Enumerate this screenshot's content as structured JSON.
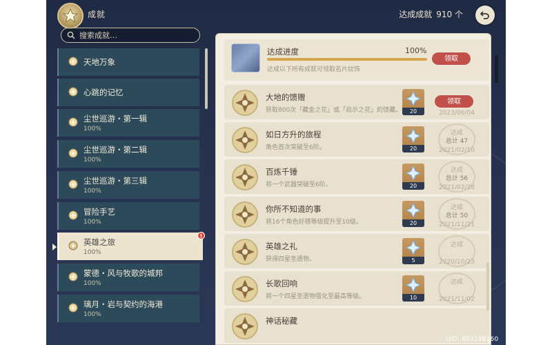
{
  "header": {
    "title": "成就",
    "total_label": "达成成就",
    "total_count": "910",
    "count_suffix": "个"
  },
  "search": {
    "placeholder": "搜索成就…"
  },
  "categories": [
    {
      "name": "天地万象",
      "percent": ""
    },
    {
      "name": "心跳的记忆",
      "percent": ""
    },
    {
      "name": "尘世巡游・第一辑",
      "percent": "100%"
    },
    {
      "name": "尘世巡游・第二辑",
      "percent": "100%"
    },
    {
      "name": "尘世巡游・第三辑",
      "percent": "100%"
    },
    {
      "name": "冒险手艺",
      "percent": "100%"
    },
    {
      "name": "英雄之旅",
      "percent": "100%"
    },
    {
      "name": "蒙德・风与牧歌的城邦",
      "percent": "100%"
    },
    {
      "name": "璃月・岩与契约的海港",
      "percent": "100%"
    }
  ],
  "selected_category_badge": "!",
  "progress": {
    "label": "达成进度",
    "percent": "100%",
    "fraction": 1.0,
    "description": "达成以下所有成就可领取名片纹饰",
    "claim_label": "领取"
  },
  "achievements": [
    {
      "name": "大地的馈赠",
      "description": "获取800次「藏金之花」或「启示之花」的馈藏。",
      "reward": "20",
      "status": "",
      "total": "",
      "date": "2023/06/04",
      "claim_label": "领取"
    },
    {
      "name": "如日方升的旅程",
      "description": "角色首次突破至6阶。",
      "reward": "20",
      "status": "达成",
      "total": "总计 47",
      "date": "2021/02/10"
    },
    {
      "name": "百炼千锤",
      "description": "将一个武器突破至6阶。",
      "reward": "20",
      "status": "达成",
      "total": "总计 56",
      "date": "2021/02/28"
    },
    {
      "name": "你所不知道的事",
      "description": "将16个角色好感等级提升至10级。",
      "reward": "20",
      "status": "达成",
      "total": "总计 50",
      "date": "2021/11/21"
    },
    {
      "name": "英雄之礼",
      "description": "获得四星圣遗物。",
      "reward": "5",
      "status": "达成",
      "total": "",
      "date": "2020/10/23"
    },
    {
      "name": "长歌回响",
      "description": "将一个四星圣遗物强化至最高等级。",
      "reward": "10",
      "status": "达成",
      "total": "",
      "date": "2021/11/02"
    },
    {
      "name": "神话秘藏",
      "description": "",
      "reward": "",
      "status": "",
      "total": "",
      "date": ""
    }
  ],
  "uid": "UID: 803198160",
  "colors": {
    "claim_button": "#c2504a",
    "progress_fill": "#d7a54a",
    "category_bg": "#2c4a5a",
    "selected_bg": "#ece4cf"
  },
  "icons": {
    "header": "achievement-emblem-icon",
    "back": "back-arrow-icon",
    "search": "search-icon",
    "reward": "primogem-icon"
  }
}
